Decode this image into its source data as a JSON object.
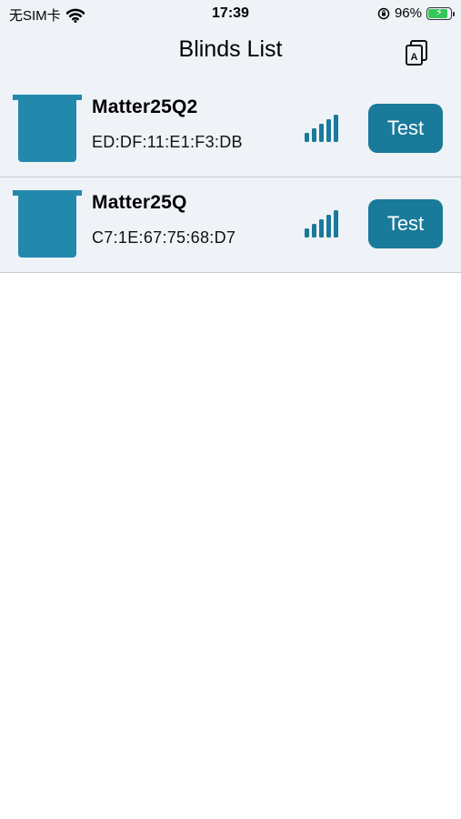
{
  "status_bar": {
    "carrier": "无SIM卡",
    "time": "17:39",
    "battery_percent": "96%",
    "battery_level": 0.96,
    "icons": [
      "wifi-icon",
      "orientation-lock-icon",
      "battery-charging-icon"
    ]
  },
  "nav": {
    "title": "Blinds List",
    "action_icon": "language-switch-icon"
  },
  "colors": {
    "accent": "#1a7a9a",
    "icon_fill": "#2289ad",
    "background": "#eff2f6"
  },
  "devices": [
    {
      "name": "Matter25Q2",
      "mac": "ED:DF:11:E1:F3:DB",
      "button_label": "Test",
      "signal_bars": 5
    },
    {
      "name": "Matter25Q",
      "mac": "C7:1E:67:75:68:D7",
      "button_label": "Test",
      "signal_bars": 5
    }
  ]
}
